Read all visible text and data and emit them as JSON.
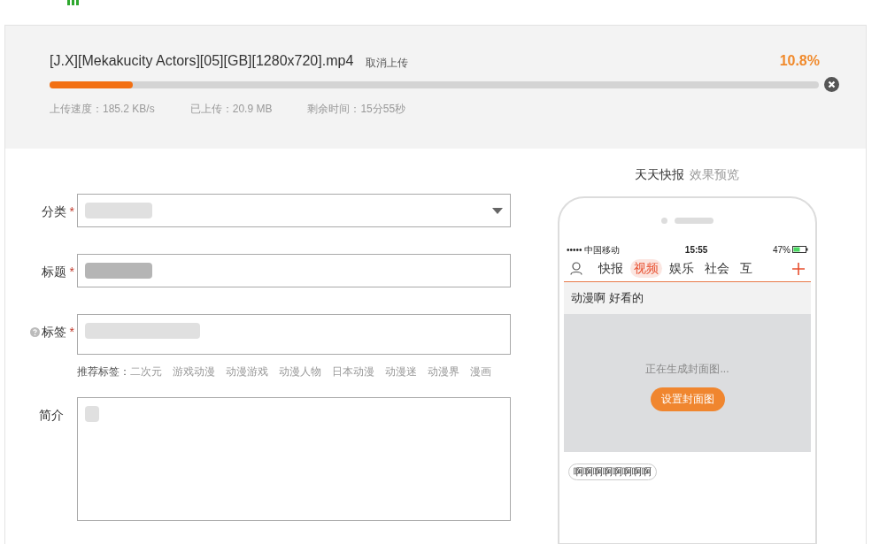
{
  "upload": {
    "filename": "[J.X][Mekakucity Actors][05][GB][1280x720].mp4",
    "cancel_label": "取消上传",
    "percent": "10.8%",
    "level": 0.108,
    "stats": [
      "上传速度：185.2 KB/s",
      "已上传：20.9 MB",
      "剩余时间：15分55秒"
    ]
  },
  "form": {
    "required_mark": "*",
    "fields": [
      {
        "label": "分类",
        "required": true,
        "kind": "select",
        "help": false
      },
      {
        "label": "标题",
        "required": true,
        "kind": "input",
        "help": false
      },
      {
        "label": "标签",
        "required": true,
        "kind": "tags",
        "help": true,
        "recommended": {
          "label": "推荐标签：",
          "tags": [
            "二次元",
            "游戏动漫",
            "动漫游戏",
            "动漫人物",
            "日本动漫",
            "动漫迷",
            "动漫界",
            "漫画"
          ]
        }
      },
      {
        "label": "简介",
        "required": false,
        "kind": "textarea",
        "help": false
      }
    ]
  },
  "preview": {
    "title": "天天快报",
    "subtitle": "效果预览",
    "status": {
      "carrier": "••••• 中国移动",
      "time": "15:55",
      "battery": "47%"
    },
    "tabs": [
      {
        "label": "快报",
        "selected": false
      },
      {
        "label": "视频",
        "selected": true
      },
      {
        "label": "娱乐",
        "selected": false
      },
      {
        "label": "社会",
        "selected": false
      },
      {
        "label": "互",
        "selected": false
      }
    ],
    "headline": "动漫啊 好看的",
    "generating": "正在生成封面图...",
    "cover_button": "设置封面图",
    "tag": "啊啊啊啊啊啊啊啊"
  }
}
